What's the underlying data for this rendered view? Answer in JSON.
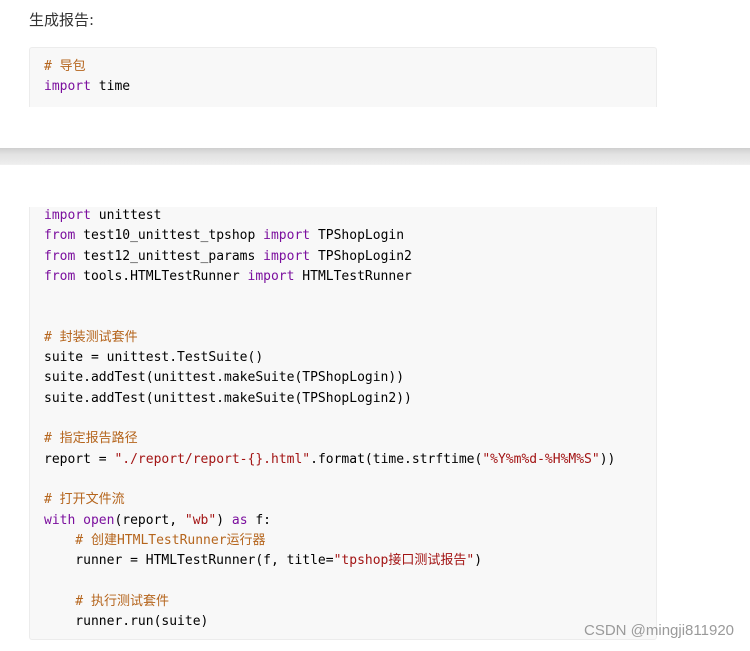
{
  "heading": "生成报告:",
  "code_top": [
    [
      {
        "t": "# 导包",
        "c": "comment"
      }
    ],
    [
      {
        "t": "import",
        "c": "keyword"
      },
      {
        "t": " time",
        "c": ""
      }
    ]
  ],
  "code_bottom": [
    [
      {
        "t": "import",
        "c": "keyword"
      },
      {
        "t": " unittest",
        "c": ""
      }
    ],
    [
      {
        "t": "from",
        "c": "keyword"
      },
      {
        "t": " test10_unittest_tpshop ",
        "c": ""
      },
      {
        "t": "import",
        "c": "keyword"
      },
      {
        "t": " TPShopLogin",
        "c": ""
      }
    ],
    [
      {
        "t": "from",
        "c": "keyword"
      },
      {
        "t": " test12_unittest_params ",
        "c": ""
      },
      {
        "t": "import",
        "c": "keyword"
      },
      {
        "t": " TPShopLogin2",
        "c": ""
      }
    ],
    [
      {
        "t": "from",
        "c": "keyword"
      },
      {
        "t": " tools.HTMLTestRunner ",
        "c": ""
      },
      {
        "t": "import",
        "c": "keyword"
      },
      {
        "t": " HTMLTestRunner",
        "c": ""
      }
    ],
    [],
    [],
    [
      {
        "t": "# 封装测试套件",
        "c": "comment"
      }
    ],
    [
      {
        "t": "suite = unittest.TestSuite()",
        "c": ""
      }
    ],
    [
      {
        "t": "suite.addTest(unittest.makeSuite(TPShopLogin))",
        "c": ""
      }
    ],
    [
      {
        "t": "suite.addTest(unittest.makeSuite(TPShopLogin2))",
        "c": ""
      }
    ],
    [],
    [
      {
        "t": "# 指定报告路径",
        "c": "comment"
      }
    ],
    [
      {
        "t": "report = ",
        "c": ""
      },
      {
        "t": "\"./report/report-{}.html\"",
        "c": "string"
      },
      {
        "t": ".format(time.strftime(",
        "c": ""
      },
      {
        "t": "\"%Y%m%d-%H%M%S\"",
        "c": "string"
      },
      {
        "t": "))",
        "c": ""
      }
    ],
    [],
    [
      {
        "t": "# 打开文件流",
        "c": "comment"
      }
    ],
    [
      {
        "t": "with",
        "c": "keyword"
      },
      {
        "t": " ",
        "c": ""
      },
      {
        "t": "open",
        "c": "builtin"
      },
      {
        "t": "(report, ",
        "c": ""
      },
      {
        "t": "\"wb\"",
        "c": "string"
      },
      {
        "t": ") ",
        "c": ""
      },
      {
        "t": "as",
        "c": "keyword"
      },
      {
        "t": " f:",
        "c": ""
      }
    ],
    [
      {
        "t": "    # 创建HTMLTestRunner运行器",
        "c": "comment"
      }
    ],
    [
      {
        "t": "    runner = HTMLTestRunner(f, title=",
        "c": ""
      },
      {
        "t": "\"tpshop接口测试报告\"",
        "c": "string"
      },
      {
        "t": ")",
        "c": ""
      }
    ],
    [],
    [
      {
        "t": "    # 执行测试套件",
        "c": "comment"
      }
    ],
    [
      {
        "t": "    runner.run(suite)",
        "c": ""
      }
    ]
  ],
  "watermark": "CSDN @mingji811920",
  "colors": {
    "comment": "#b5651d",
    "keyword": "#7b0f9e",
    "string": "#a31515",
    "code_bg": "#f8f8f8"
  }
}
